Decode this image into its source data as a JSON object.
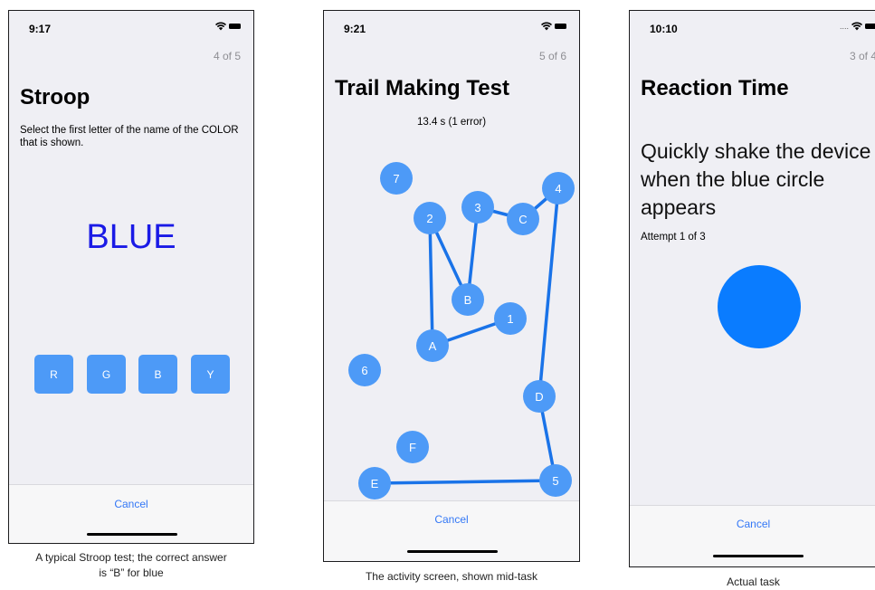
{
  "colors": {
    "accent": "#3478f6",
    "node_fill": "#4d9af7",
    "trail_line": "#1a73e8",
    "stroop_word": "#1a1ae6",
    "rt_circle": "#0a7cff"
  },
  "icons": [
    "wifi-icon",
    "battery-icon",
    "signal-dots-icon"
  ],
  "screens": {
    "stroop": {
      "time": "9:17",
      "progress": "4 of 5",
      "title": "Stroop",
      "instructions": "Select the first letter of the name of the COLOR that is shown.",
      "word": "BLUE",
      "choices": [
        "R",
        "G",
        "B",
        "Y"
      ],
      "cancel": "Cancel",
      "caption_line1": "A typical Stroop test; the correct answer",
      "caption_line2": "is “B” for blue"
    },
    "trail": {
      "time": "9:21",
      "progress": "5 of 6",
      "title": "Trail Making Test",
      "status": "13.4 s (1 error)",
      "nodes": [
        "7",
        "2",
        "3",
        "C",
        "4",
        "B",
        "1",
        "A",
        "6",
        "D",
        "F",
        "E",
        "5"
      ],
      "cancel": "Cancel",
      "caption": "The activity screen, shown mid-task"
    },
    "reaction": {
      "time": "10:10",
      "progress": "3 of 4",
      "title": "Reaction Time",
      "instructions": "Quickly shake the device when the blue circle appears",
      "attempt": "Attempt 1 of 3",
      "cancel": "Cancel",
      "caption": "Actual task"
    }
  }
}
